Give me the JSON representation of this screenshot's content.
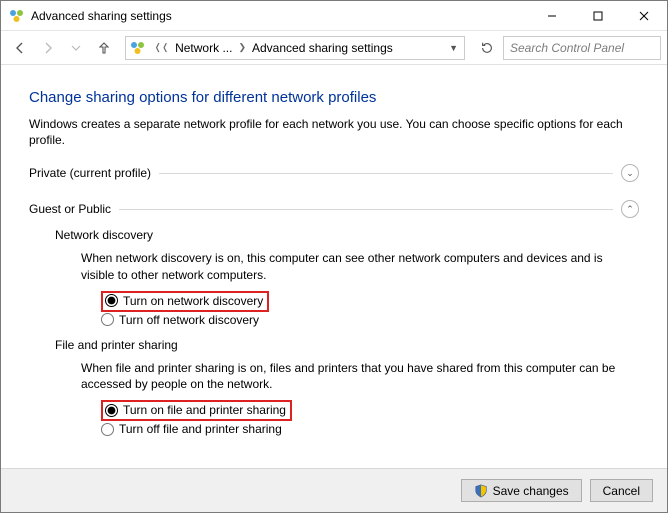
{
  "window": {
    "title": "Advanced sharing settings"
  },
  "breadcrumb": {
    "item1": "Network ...",
    "item2": "Advanced sharing settings"
  },
  "search": {
    "placeholder": "Search Control Panel"
  },
  "page": {
    "heading": "Change sharing options for different network profiles",
    "description": "Windows creates a separate network profile for each network you use. You can choose specific options for each profile."
  },
  "sections": {
    "private": {
      "label": "Private (current profile)"
    },
    "guest": {
      "label": "Guest or Public",
      "network_discovery": {
        "title": "Network discovery",
        "desc": "When network discovery is on, this computer can see other network computers and devices and is visible to other network computers.",
        "on": "Turn on network discovery",
        "off": "Turn off network discovery"
      },
      "file_sharing": {
        "title": "File and printer sharing",
        "desc": "When file and printer sharing is on, files and printers that you have shared from this computer can be accessed by people on the network.",
        "on": "Turn on file and printer sharing",
        "off": "Turn off file and printer sharing"
      }
    }
  },
  "footer": {
    "save": "Save changes",
    "cancel": "Cancel"
  }
}
